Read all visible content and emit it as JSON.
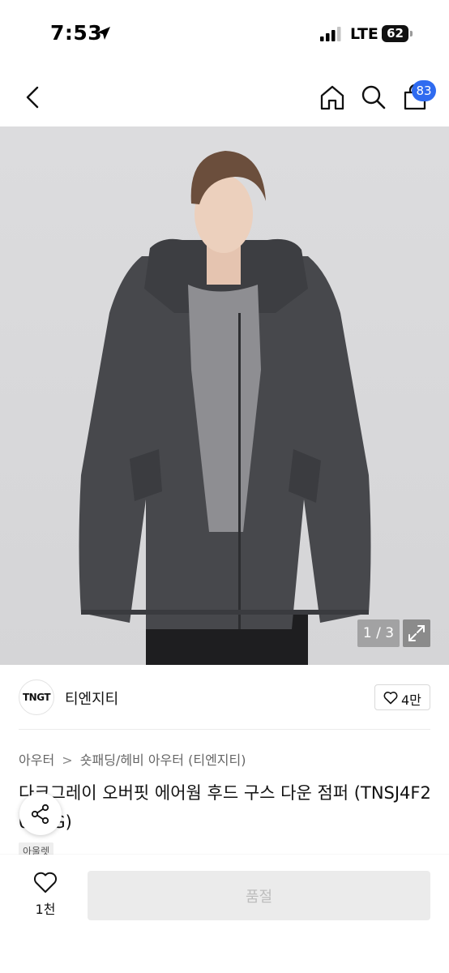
{
  "status_bar": {
    "time": "7:53",
    "network": "LTE",
    "battery": "62"
  },
  "nav": {
    "cart_count": "83",
    "icons": [
      "chevron-left-icon",
      "home-icon",
      "search-icon",
      "shopping-bag-icon"
    ]
  },
  "product": {
    "image_counter": "1 / 3",
    "brand_logo": "TNGT",
    "brand_name": "티엔지티",
    "brand_likes": "4만",
    "breadcrumb": [
      "아우터",
      "숏패딩/헤비 아우터",
      "(티엔지티)"
    ],
    "breadcrumb_separator": ">",
    "title": "다크그레이 오버핏 에어웜 후드 구스 다운 점퍼 (TNSJ4F202CG)",
    "badge": "아울렛"
  },
  "bottom_bar": {
    "wish_count": "1천",
    "buy_label": "품절"
  },
  "colors": {
    "accent": "#2f6bf0",
    "soldout_bg": "#ebebeb",
    "soldout_text": "#bdbdbd"
  }
}
